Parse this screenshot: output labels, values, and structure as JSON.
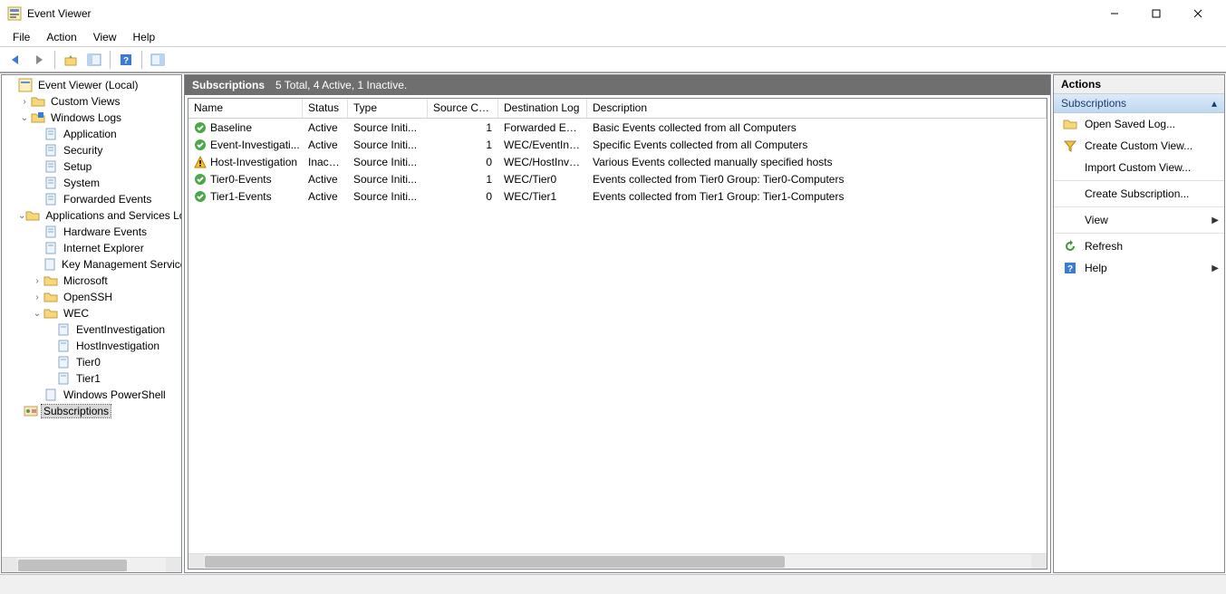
{
  "window": {
    "title": "Event Viewer"
  },
  "menu": {
    "file": "File",
    "action": "Action",
    "view": "View",
    "help": "Help"
  },
  "tree": {
    "root": "Event Viewer (Local)",
    "custom_views": "Custom Views",
    "windows_logs": "Windows Logs",
    "wl_items": [
      "Application",
      "Security",
      "Setup",
      "System",
      "Forwarded Events"
    ],
    "apps_services": "Applications and Services Logs",
    "as_hardware": "Hardware Events",
    "as_ie": "Internet Explorer",
    "as_kms": "Key Management Service",
    "as_microsoft": "Microsoft",
    "as_openssh": "OpenSSH",
    "as_wec": "WEC",
    "wec_items": [
      "EventInvestigation",
      "HostInvestigation",
      "Tier0",
      "Tier1"
    ],
    "as_powershell": "Windows PowerShell",
    "subscriptions": "Subscriptions"
  },
  "center": {
    "title": "Subscriptions",
    "summary": "5 Total, 4 Active, 1 Inactive.",
    "columns": {
      "name": "Name",
      "status": "Status",
      "type": "Type",
      "source": "Source Co...",
      "dest": "Destination Log",
      "desc": "Description"
    },
    "rows": [
      {
        "icon": "ok",
        "name": "Baseline",
        "status": "Active",
        "type": "Source Initi...",
        "src": "1",
        "dest": "Forwarded Eve...",
        "desc": "Basic Events collected from all Computers"
      },
      {
        "icon": "ok",
        "name": "Event-Investigati...",
        "status": "Active",
        "type": "Source Initi...",
        "src": "1",
        "dest": "WEC/EventInve...",
        "desc": "Specific Events collected from all Computers"
      },
      {
        "icon": "warn",
        "name": "Host-Investigation",
        "status": "Inactive",
        "type": "Source Initi...",
        "src": "0",
        "dest": "WEC/HostInve...",
        "desc": "Various Events collected manually specified hosts"
      },
      {
        "icon": "ok",
        "name": "Tier0-Events",
        "status": "Active",
        "type": "Source Initi...",
        "src": "1",
        "dest": "WEC/Tier0",
        "desc": "Events collected from Tier0 Group: Tier0-Computers"
      },
      {
        "icon": "ok",
        "name": "Tier1-Events",
        "status": "Active",
        "type": "Source Initi...",
        "src": "0",
        "dest": "WEC/Tier1",
        "desc": "Events collected from Tier1 Group: Tier1-Computers"
      }
    ]
  },
  "actions": {
    "pane_title": "Actions",
    "section": "Subscriptions",
    "open_saved": "Open Saved Log...",
    "create_custom": "Create Custom View...",
    "import_custom": "Import Custom View...",
    "create_sub": "Create Subscription...",
    "view": "View",
    "refresh": "Refresh",
    "help": "Help"
  }
}
